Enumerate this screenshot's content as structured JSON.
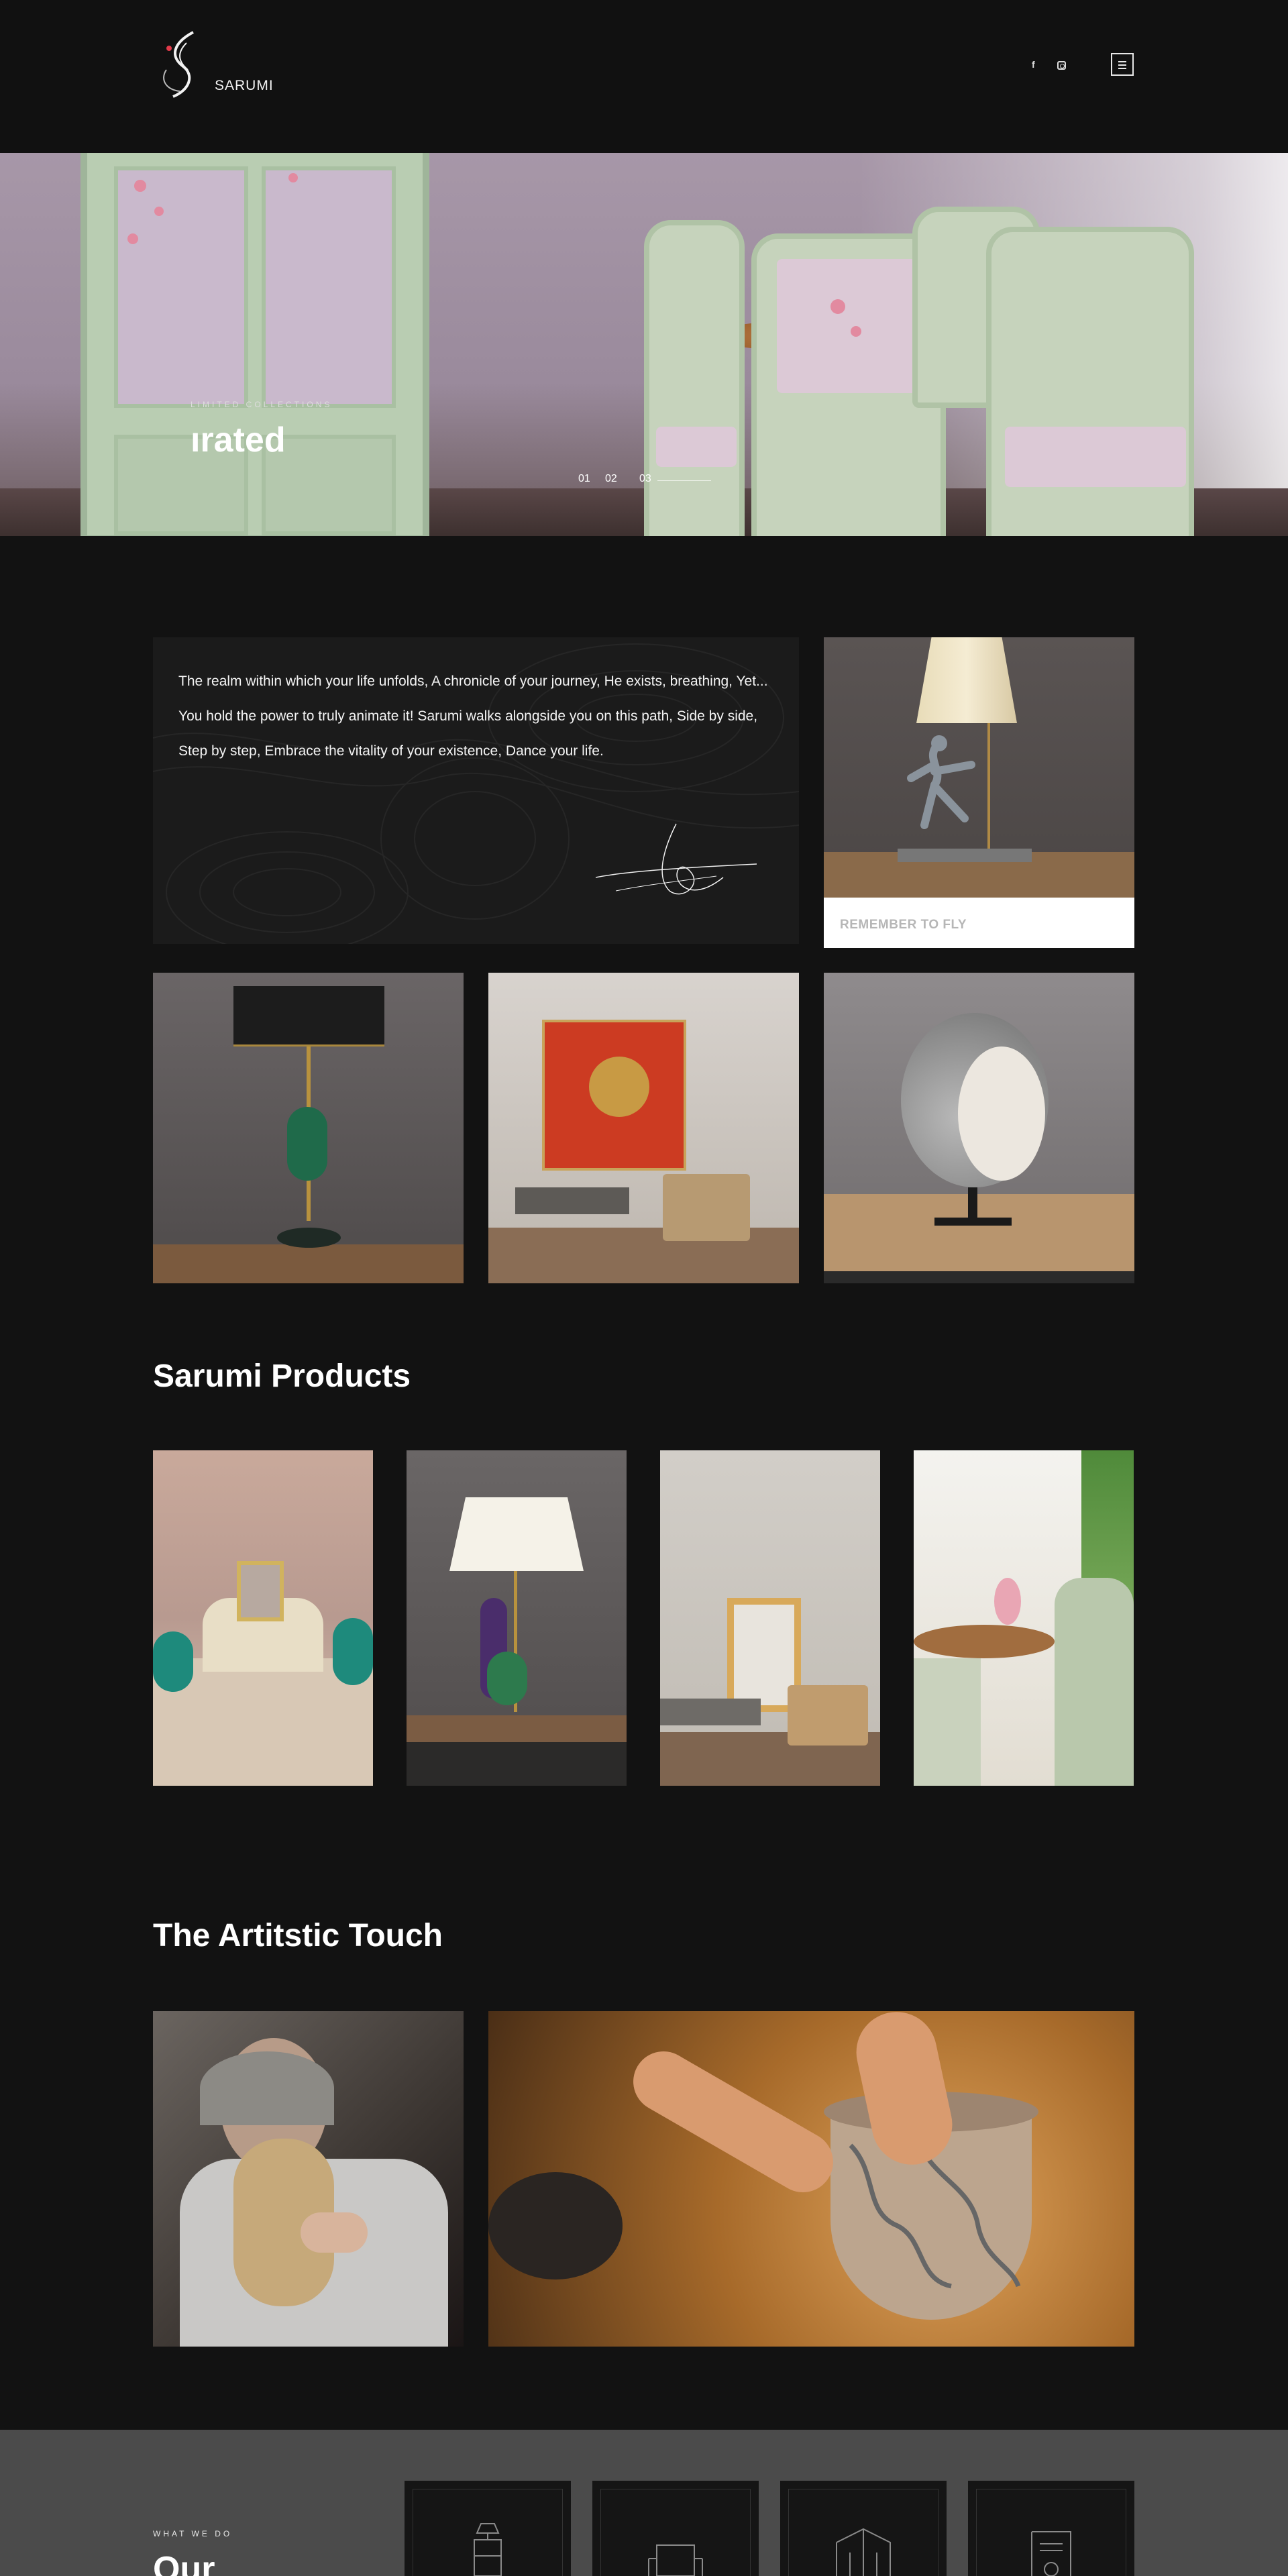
{
  "header": {
    "brand": "SARUMI",
    "social": [
      {
        "name": "facebook",
        "glyph": "f"
      },
      {
        "name": "instagram",
        "glyph": ""
      }
    ],
    "menu_icon": "hamburger-menu-icon"
  },
  "hero": {
    "caption": "LIMITED COLLECTIONS",
    "title": "ırated",
    "slides": [
      "01",
      "02",
      "03"
    ]
  },
  "intro": {
    "quote": "The realm within which your life unfolds, A chronicle of your journey, He exists, breathing, Yet... You hold the power to truly animate it! Sarumi walks alongside you on this path, Side by side, Step by step, Embrace the vitality of your existence, Dance your life.",
    "featured_caption": "REMEMBER TO FLY"
  },
  "products": {
    "title": "Sarumi Products"
  },
  "artistic": {
    "title": "The Artitstic Touch"
  },
  "services": {
    "label": "WHAT WE DO",
    "title": "Our",
    "icons": [
      "drawer-lamp-icon",
      "armchair-icon",
      "building-icon",
      "document-icon"
    ]
  },
  "colors": {
    "background": "#121212",
    "footer_band": "#4b4b4b",
    "caption_gray": "#b6b6b6"
  }
}
